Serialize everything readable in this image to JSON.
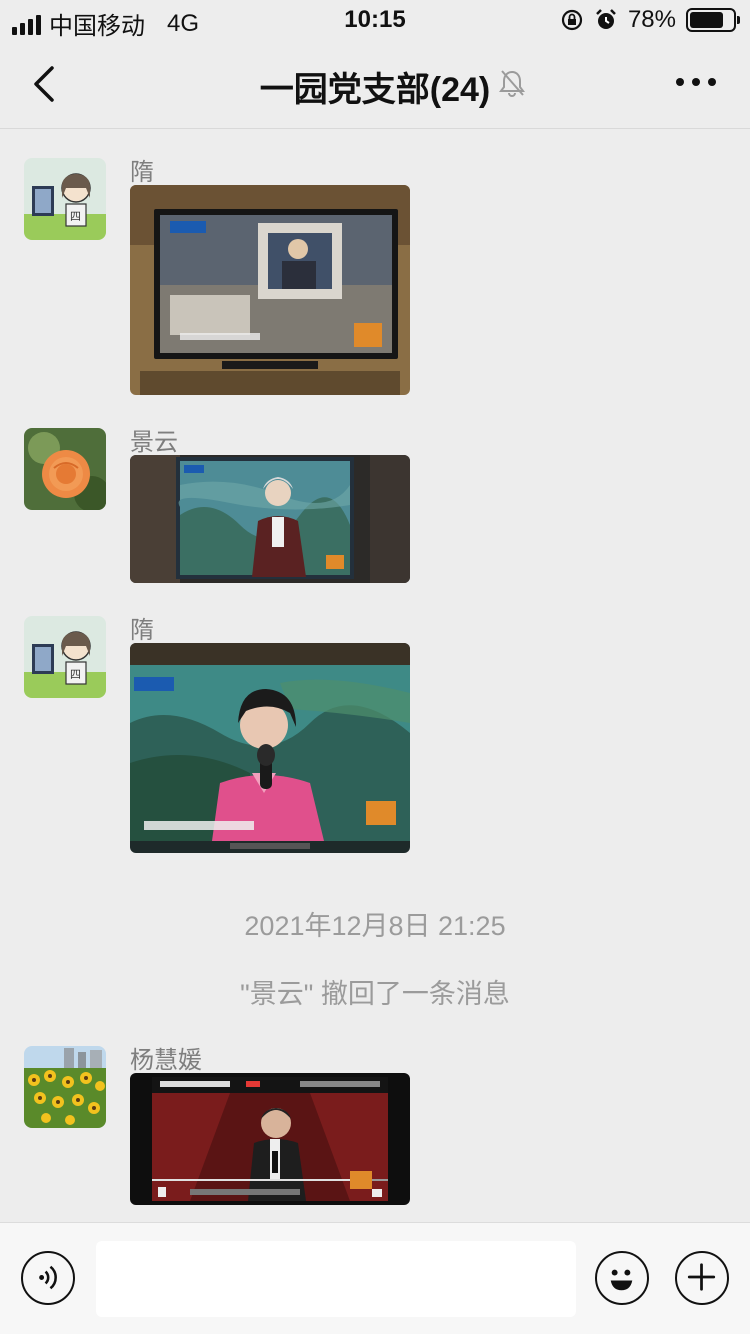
{
  "status_bar": {
    "carrier": "中国移动",
    "network": "4G",
    "time": "10:15",
    "battery_percent": "78%",
    "battery_level": 0.78
  },
  "nav": {
    "title": "一园党支部(24)",
    "back_icon": "chevron-left-icon",
    "mute_icon": "bell-muted-icon",
    "more_icon": "more-dots-icon"
  },
  "messages": [
    {
      "sender": "隋",
      "type": "image",
      "content": "TV broadcast photo"
    },
    {
      "sender": "景云",
      "type": "image",
      "content": "TV broadcast photo"
    },
    {
      "sender": "隋",
      "type": "image",
      "content": "TV broadcast photo"
    }
  ],
  "system": {
    "timestamp": "2021年12月8日 21:25",
    "recall_notice": "\"景云\" 撤回了一条消息"
  },
  "last_message": {
    "sender": "杨慧媛",
    "type": "image"
  },
  "input_bar": {
    "voice_icon": "voice-icon",
    "emoji_icon": "emoji-icon",
    "plus_icon": "plus-icon",
    "input_value": ""
  }
}
